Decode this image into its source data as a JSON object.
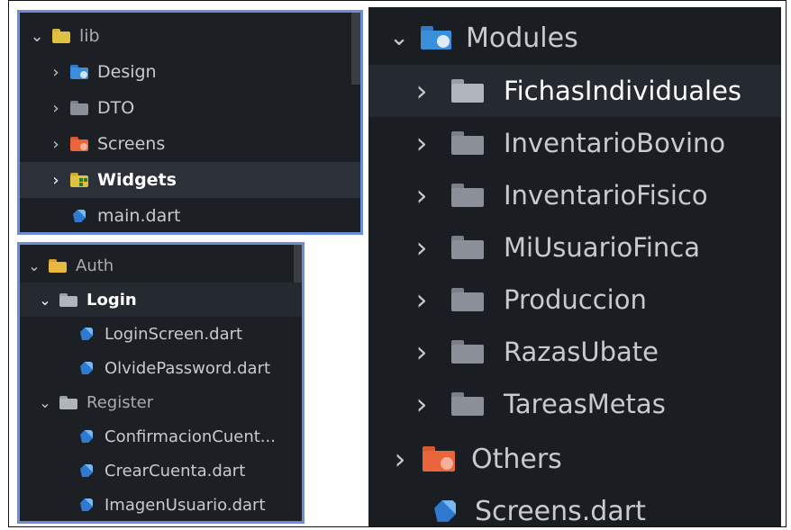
{
  "colors": {
    "panel_bg": "#1c1f24",
    "panel_border": "#6b8fd6",
    "text": "#c7cad0",
    "folder_gray": "#8a8f98",
    "folder_blue": "#3b8fd9",
    "folder_orange": "#e8663a",
    "folder_yellow": "#e0c040",
    "dart_blue": "#2f7ad0"
  },
  "lib_panel": {
    "root": {
      "label": "lib",
      "icon": "folder-open-yellow-icon"
    },
    "items": [
      {
        "label": "Design",
        "icon": "folder-design-blue-icon",
        "expanded": false
      },
      {
        "label": "DTO",
        "icon": "folder-gray-icon",
        "expanded": false
      },
      {
        "label": "Screens",
        "icon": "folder-screens-orange-icon",
        "expanded": false
      },
      {
        "label": "Widgets",
        "icon": "folder-widgets-yellow-icon",
        "expanded": false,
        "selected": true
      },
      {
        "label": "main.dart",
        "icon": "dart-file-icon"
      }
    ]
  },
  "auth_panel": {
    "root": {
      "label": "Auth",
      "icon": "folder-open-yellow-icon"
    },
    "login": {
      "label": "Login",
      "icon": "folder-open-gray-icon",
      "files": [
        "LoginScreen.dart",
        "OlvidePassword.dart"
      ]
    },
    "register": {
      "label": "Register",
      "icon": "folder-open-gray-icon",
      "files": [
        "ConfirmacionCuent...",
        "CrearCuenta.dart",
        "ImagenUsuario.dart"
      ]
    }
  },
  "modules_panel": {
    "root": {
      "label": "Modules",
      "icon": "folder-modules-blue-icon"
    },
    "items": [
      {
        "label": "FichasIndividuales",
        "selected": true
      },
      {
        "label": "InventarioBovino"
      },
      {
        "label": "InventarioFisico"
      },
      {
        "label": "MiUsuarioFinca"
      },
      {
        "label": "Produccion"
      },
      {
        "label": "RazasUbate"
      },
      {
        "label": "TareasMetas"
      }
    ],
    "others": {
      "label": "Others",
      "icon": "folder-screens-orange-icon"
    },
    "file": {
      "label": "Screens.dart",
      "icon": "dart-file-icon"
    }
  }
}
